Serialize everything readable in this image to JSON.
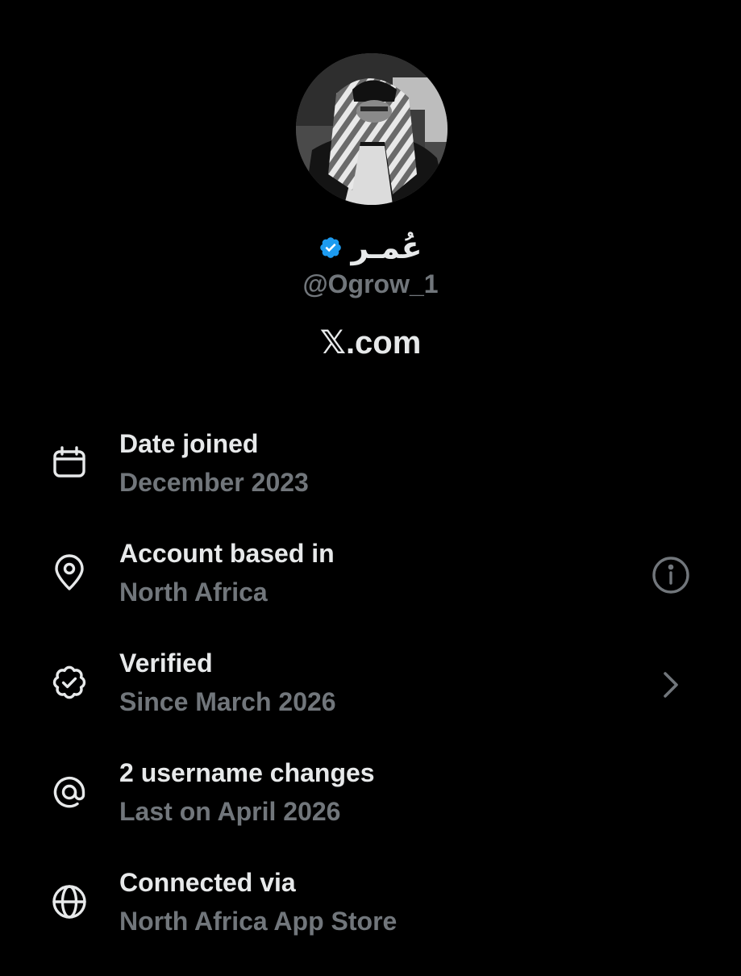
{
  "profile": {
    "display_name": "عُمـر",
    "handle": "@Ogrow_1",
    "verified": true,
    "verified_color": "#1d9bf0",
    "avatar_icon": "profile-photo-grayscale"
  },
  "site": {
    "logo": "𝕏",
    "domain": ".com"
  },
  "rows": [
    {
      "icon": "calendar-icon",
      "title": "Date joined",
      "subtitle": "December 2023",
      "action": null
    },
    {
      "icon": "location-pin-icon",
      "title": "Account based in",
      "subtitle": "North Africa",
      "action": "info-icon"
    },
    {
      "icon": "verified-badge-outline-icon",
      "title": "Verified",
      "subtitle": "Since March 2026",
      "action": "chevron-right-icon"
    },
    {
      "icon": "at-sign-icon",
      "title": "2 username changes",
      "subtitle": "Last on April 2026",
      "action": null
    },
    {
      "icon": "globe-icon",
      "title": "Connected via",
      "subtitle": "North Africa App Store",
      "action": null
    }
  ],
  "colors": {
    "background": "#000000",
    "primary_text": "#e7e9ea",
    "secondary_text": "#71767b"
  }
}
